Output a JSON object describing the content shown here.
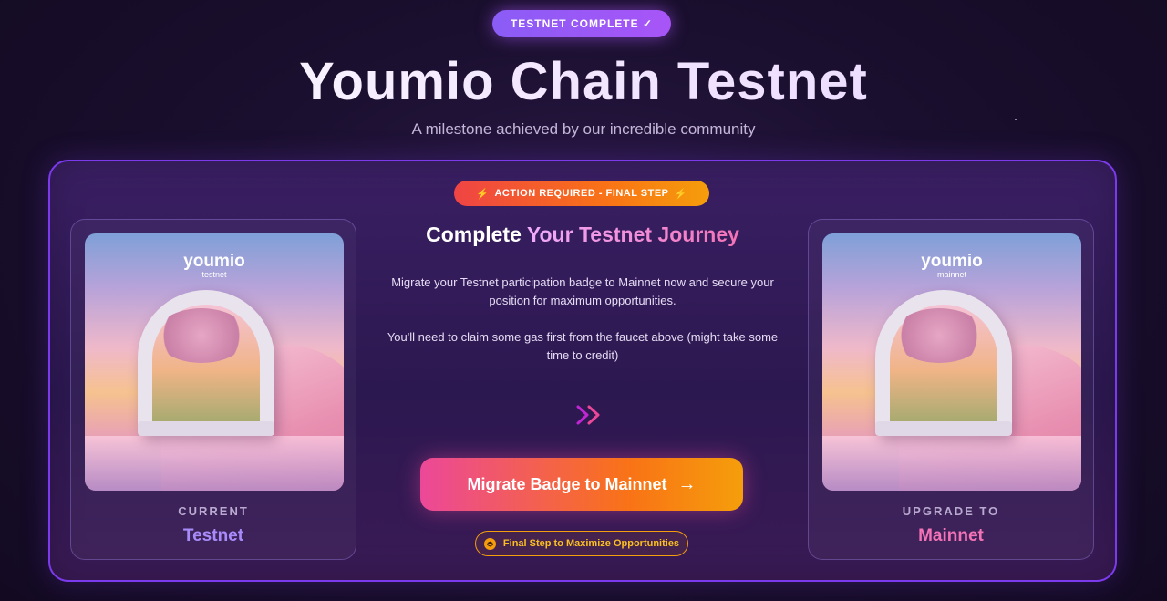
{
  "header": {
    "status_pill": "TESTNET COMPLETE ✓",
    "title": "Youmio Chain Testnet",
    "subtitle": "A milestone achieved by our incredible community"
  },
  "panel": {
    "action_pill": "ACTION REQUIRED - FINAL STEP",
    "heading_prefix": "Complete",
    "heading_accent": "Your Testnet Journey",
    "paragraph_1": "Migrate your Testnet participation badge to Mainnet now and secure your position for maximum opportunities.",
    "paragraph_2": "You'll need to claim some gas first from the faucet above (might take some time to credit)",
    "migrate_button": "Migrate Badge to Mainnet",
    "final_step_pill": "Final Step to Maximize Opportunities"
  },
  "cards": {
    "current": {
      "logo": "youmio",
      "logo_sub": "testnet",
      "label": "CURRENT",
      "value": "Testnet"
    },
    "upgrade": {
      "logo": "youmio",
      "logo_sub": "mainnet",
      "label": "UPGRADE TO",
      "value": "Mainnet"
    }
  },
  "icons": {
    "status_pill_icon": "check-icon",
    "action_pill_icon": "bolt-icon",
    "arrows_icon": "double-chevron-right-icon",
    "button_icon": "arrow-right-icon",
    "final_pill_icon": "layers-icon"
  },
  "colors": {
    "accent_purple": "#a78bfa",
    "accent_pink": "#f472b6",
    "accent_orange": "#f59e0b",
    "panel_border": "#7c3aed"
  }
}
